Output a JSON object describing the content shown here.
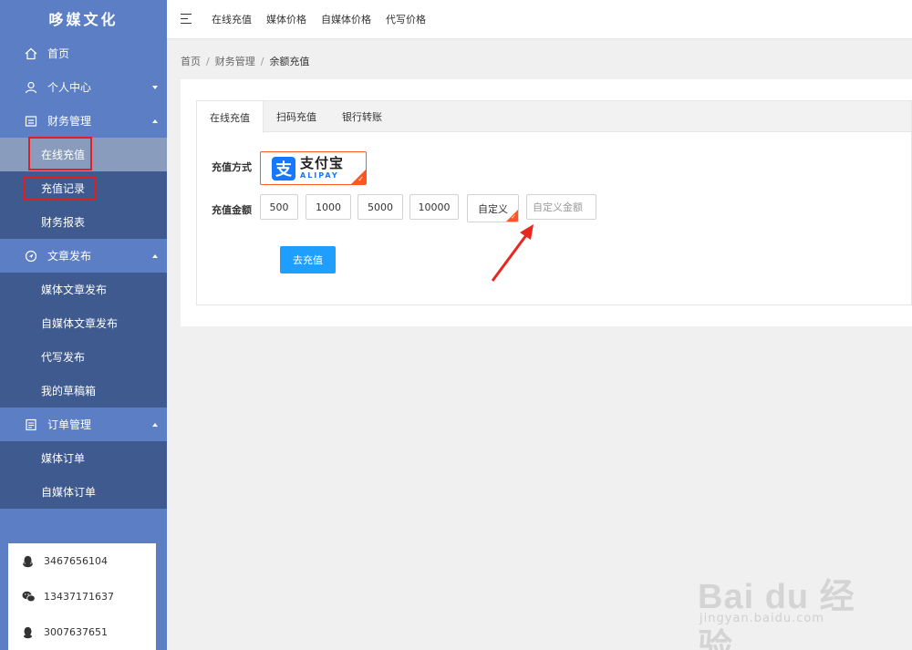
{
  "sidebar": {
    "logo": "哆媒文化",
    "home": "首页",
    "personal": "个人中心",
    "finance": {
      "label": "财务管理",
      "items": [
        "在线充值",
        "充值记录",
        "财务报表"
      ]
    },
    "article": {
      "label": "文章发布",
      "items": [
        "媒体文章发布",
        "自媒体文章发布",
        "代写发布",
        "我的草稿箱"
      ]
    },
    "orders": {
      "label": "订单管理",
      "items": [
        "媒体订单",
        "自媒体订单"
      ]
    },
    "contacts": [
      {
        "icon": "qq-icon",
        "value": "3467656104"
      },
      {
        "icon": "wechat-icon",
        "value": "13437171637"
      },
      {
        "icon": "qq-icon",
        "value": "3007637651"
      }
    ]
  },
  "topbar": {
    "links": [
      "在线充值",
      "媒体价格",
      "自媒体价格",
      "代写价格"
    ]
  },
  "breadcrumb": [
    "首页",
    "财务管理",
    "余额充值"
  ],
  "tabs": [
    "在线充值",
    "扫码充值",
    "银行转账"
  ],
  "form": {
    "method_label": "充值方式",
    "alipay_cn": "支付宝",
    "alipay_en": "ALIPAY",
    "amount_label": "充值金额",
    "amounts": [
      "500",
      "1000",
      "5000",
      "10000"
    ],
    "custom_label": "自定义",
    "custom_placeholder": "自定义金额",
    "submit": "去充值"
  },
  "watermark": {
    "main": "Bai du 经验",
    "sub": "jingyan.baidu.com"
  },
  "colors": {
    "sidebar": "#5b7ec4",
    "sidebar_sub": "#3e5a8f",
    "accent": "#1e9fff",
    "selected": "#ff5722",
    "highlight_box": "#e02020"
  }
}
